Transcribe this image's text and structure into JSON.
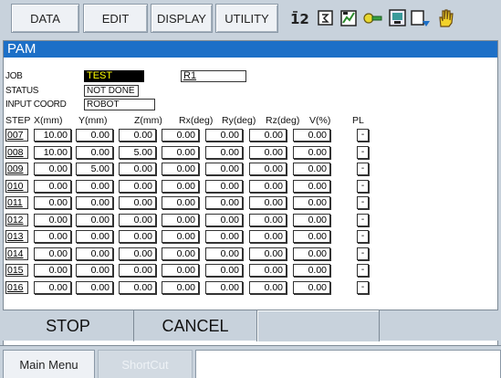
{
  "menu": {
    "data_label": "DATA",
    "edit_label": "EDIT",
    "display_label": "DISPLAY",
    "utility_label": "UTILITY"
  },
  "toolbar_icons": [
    "program-step-icon",
    "instruction-list-icon",
    "monitor-chart-icon",
    "tool-key-icon",
    "camera-screen-icon",
    "screen-copy-icon",
    "servo-hand-icon"
  ],
  "window": {
    "title": "PAM"
  },
  "fields": {
    "job_label": "JOB",
    "job_value": "TEST",
    "robot_value": "R1",
    "status_label": "STATUS",
    "status_value": "NOT DONE",
    "coord_label": "INPUT COORD",
    "coord_value": "ROBOT"
  },
  "table": {
    "headers": [
      "STEP",
      "X(mm)",
      "Y(mm)",
      "Z(mm)",
      "Rx(deg)",
      "Ry(deg)",
      "Rz(deg)",
      "V(%)",
      "PL"
    ],
    "rows": [
      {
        "step": "007",
        "x": "10.00",
        "y": "0.00",
        "z": "0.00",
        "rx": "0.00",
        "ry": "0.00",
        "rz": "0.00",
        "v": "0.00",
        "pl": "-"
      },
      {
        "step": "008",
        "x": "10.00",
        "y": "0.00",
        "z": "5.00",
        "rx": "0.00",
        "ry": "0.00",
        "rz": "0.00",
        "v": "0.00",
        "pl": "-"
      },
      {
        "step": "009",
        "x": "0.00",
        "y": "5.00",
        "z": "0.00",
        "rx": "0.00",
        "ry": "0.00",
        "rz": "0.00",
        "v": "0.00",
        "pl": "-"
      },
      {
        "step": "010",
        "x": "0.00",
        "y": "0.00",
        "z": "0.00",
        "rx": "0.00",
        "ry": "0.00",
        "rz": "0.00",
        "v": "0.00",
        "pl": "-"
      },
      {
        "step": "011",
        "x": "0.00",
        "y": "0.00",
        "z": "0.00",
        "rx": "0.00",
        "ry": "0.00",
        "rz": "0.00",
        "v": "0.00",
        "pl": "-"
      },
      {
        "step": "012",
        "x": "0.00",
        "y": "0.00",
        "z": "0.00",
        "rx": "0.00",
        "ry": "0.00",
        "rz": "0.00",
        "v": "0.00",
        "pl": "-"
      },
      {
        "step": "013",
        "x": "0.00",
        "y": "0.00",
        "z": "0.00",
        "rx": "0.00",
        "ry": "0.00",
        "rz": "0.00",
        "v": "0.00",
        "pl": "-"
      },
      {
        "step": "014",
        "x": "0.00",
        "y": "0.00",
        "z": "0.00",
        "rx": "0.00",
        "ry": "0.00",
        "rz": "0.00",
        "v": "0.00",
        "pl": "-"
      },
      {
        "step": "015",
        "x": "0.00",
        "y": "0.00",
        "z": "0.00",
        "rx": "0.00",
        "ry": "0.00",
        "rz": "0.00",
        "v": "0.00",
        "pl": "-"
      },
      {
        "step": "016",
        "x": "0.00",
        "y": "0.00",
        "z": "0.00",
        "rx": "0.00",
        "ry": "0.00",
        "rz": "0.00",
        "v": "0.00",
        "pl": "-"
      }
    ]
  },
  "actions": {
    "stop_label": "STOP",
    "cancel_label": "CANCEL"
  },
  "footer": {
    "main_menu_label": "Main Menu",
    "shortcut_label": "ShortCut"
  },
  "colors": {
    "title_bar": "#1c6fc7",
    "job_highlight_bg": "#000000",
    "job_highlight_text": "#ffff00",
    "background": "#c8d2dc"
  }
}
